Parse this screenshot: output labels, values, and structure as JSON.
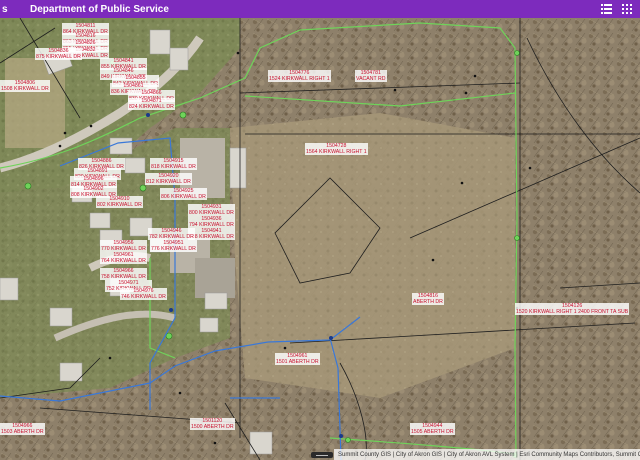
{
  "header": {
    "back_label": "s",
    "title": "Department of Public Service",
    "icons": [
      "list-icon",
      "grid-icon"
    ]
  },
  "map": {
    "labels": [
      "1504806\n1508 KIRKWALL DR",
      "1504811\n864 KIRKWALL DR",
      "1504816\n863 KIRKWALL DR",
      "1504826\n855 KIRKWALL DR",
      "1504832\n823 KIRKWALL DR",
      "1504836\n875 KIRKWALL DR",
      "1504841\n855 KIRKWALL DR",
      "1504846\n849 KIRKWALL DR",
      "1504855\n842 KIRKWALL DR",
      "1504861\n836 KIRKWALL DR",
      "1504866\n830 KIRKWALL DR",
      "1504871\n824 KIRKWALL DR",
      "1504776\n1524 KIRKWALL RIGHT 1",
      "1504781\nVACANT RD",
      "1504886\n826 KIRKWALL DR",
      "1504891\n820 KIRKWALL DR",
      "1504896\n814 KIRKWALL DR",
      "1504902\n808 KIRKWALL DR",
      "1504910\n802 KIRKWALL DR",
      "1504915\n818 KIRKWALL DR",
      "1504920\n812 KIRKWALL DR",
      "1504925\n806 KIRKWALL DR",
      "1504931\n800 KIRKWALL DR",
      "1504936\n794 KIRKWALL DR",
      "1504941\n788 KIRKWALL DR",
      "1504946\n782 KIRKWALL DR",
      "1504951\n776 KIRKWALL DR",
      "1504956\n770 KIRKWALL DR",
      "1504961\n764 KIRKWALL DR",
      "1504966\n758 KIRKWALL DR",
      "1504971\n752 KIRKWALL DR",
      "1504976\n746 KIRKWALL DR",
      "1504728\n1564 KIRKWALL RIGHT 1",
      "1504816\nABERTH DR",
      "1504126\n1520 KIRKWALL RIGHT 1 2400 FRONT TA SUB",
      "1501120\n1500 ABERTH DR",
      "1504961\n1501 ABERTH DR",
      "1504944\n1505 ABERTH DR",
      "1504966\n1503 ABERTH DR"
    ]
  },
  "attribution": "Summit County GIS | City of Akron GIS | City of Akron AVL System | Esri Community Maps Contributors, Summit County"
}
